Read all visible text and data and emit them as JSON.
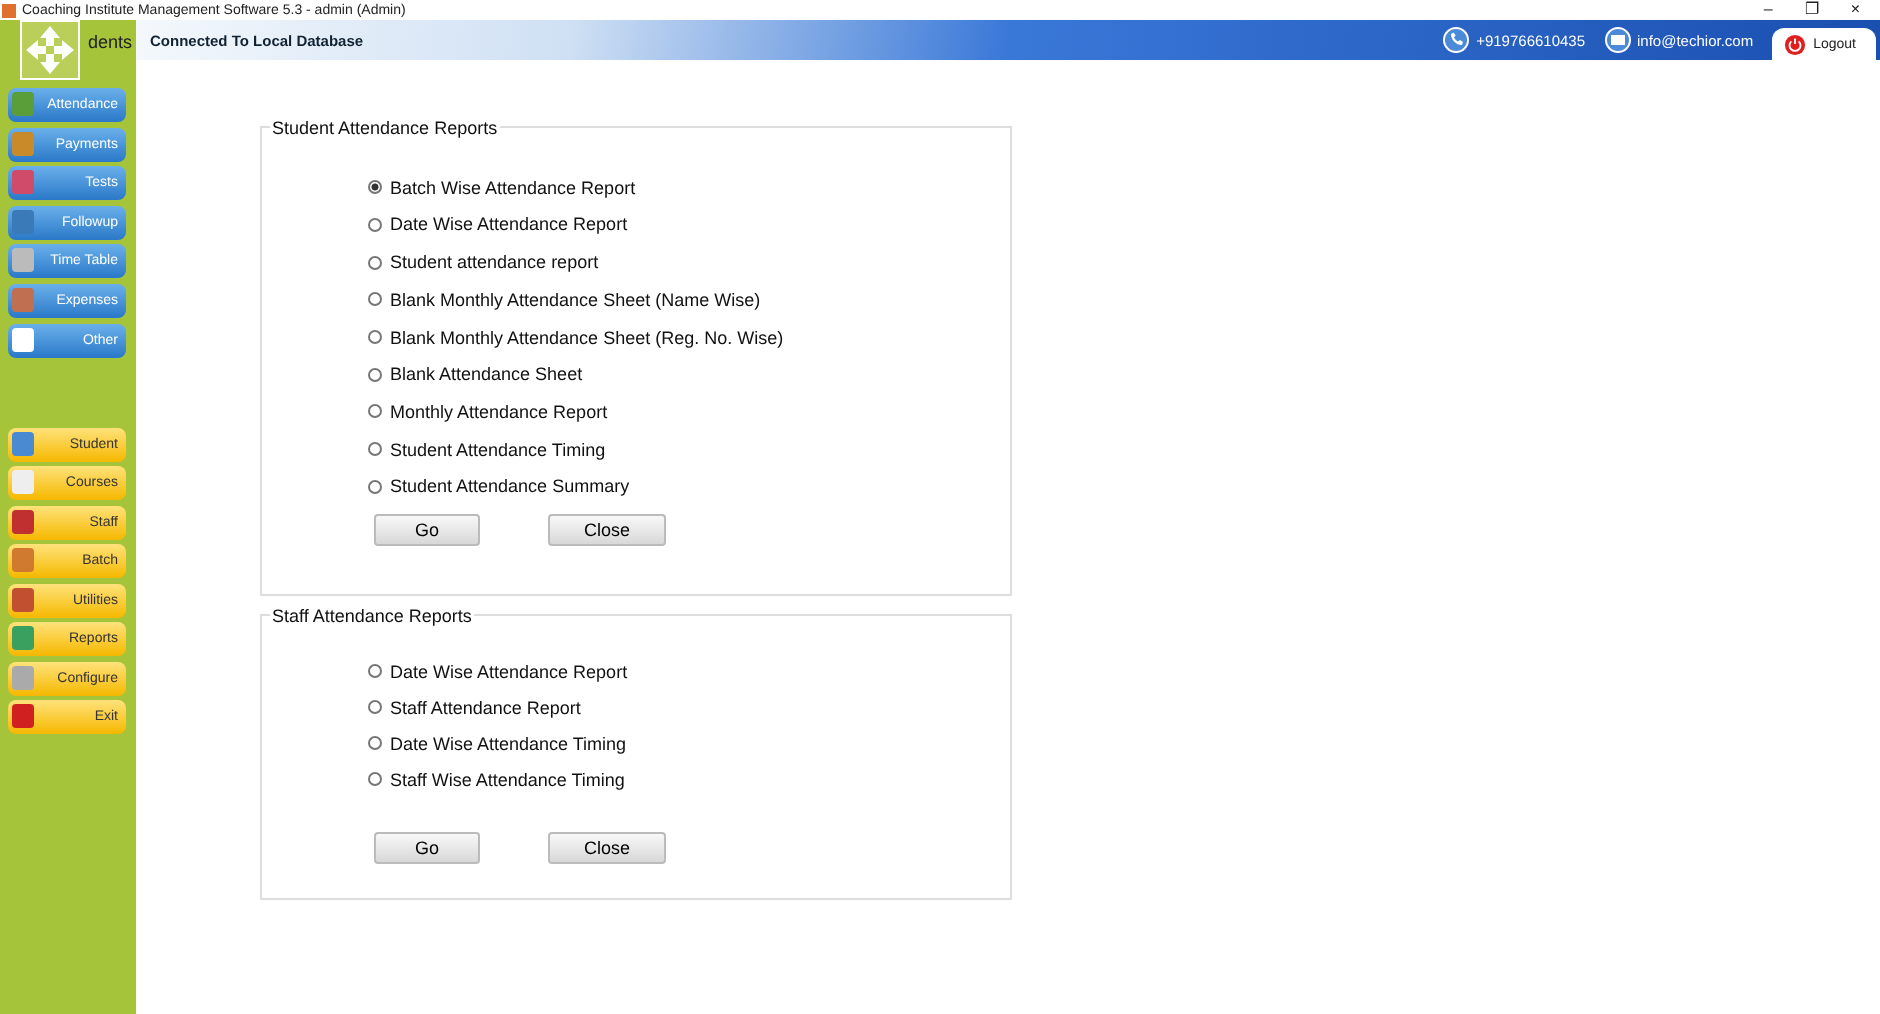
{
  "window": {
    "title": "Coaching Institute Management Software 5.3  -  admin (Admin)",
    "controls": [
      "–",
      "❐",
      "×"
    ]
  },
  "header": {
    "page_title": "dents",
    "connection": "Connected To  Local Database",
    "phone": "+919766610435",
    "email": "info@techior.com",
    "logout": "Logout"
  },
  "sidebar": {
    "top_items": [
      "Attendance",
      "Payments",
      "Tests",
      "Followup",
      "Time Table",
      "Expenses",
      "Other"
    ],
    "bottom_items": [
      "Student",
      "Courses",
      "Staff",
      "Batch",
      "Utilities",
      "Reports",
      "Configure",
      "Exit"
    ]
  },
  "groups": [
    {
      "title": "Student Attendance Reports",
      "options": [
        {
          "label": "Batch Wise Attendance Report",
          "selected": true
        },
        {
          "label": "Date Wise Attendance Report",
          "selected": false
        },
        {
          "label": "Student attendance report",
          "selected": false
        },
        {
          "label": "Blank Monthly Attendance Sheet (Name Wise)",
          "selected": false
        },
        {
          "label": "Blank Monthly Attendance Sheet (Reg. No. Wise)",
          "selected": false
        },
        {
          "label": "Blank Attendance Sheet",
          "selected": false
        },
        {
          "label": "Monthly Attendance Report",
          "selected": false
        },
        {
          "label": "Student Attendance Timing",
          "selected": false
        },
        {
          "label": "Student Attendance Summary",
          "selected": false
        }
      ],
      "buttons": [
        "Go",
        "Close"
      ]
    },
    {
      "title": "Staff Attendance Reports",
      "options": [
        {
          "label": "Date Wise Attendance Report",
          "selected": false
        },
        {
          "label": "Staff Attendance Report",
          "selected": false
        },
        {
          "label": "Date Wise Attendance Timing",
          "selected": false
        },
        {
          "label": "Staff Wise Attendance Timing",
          "selected": false
        }
      ],
      "buttons": [
        "Go",
        "Close"
      ]
    }
  ]
}
